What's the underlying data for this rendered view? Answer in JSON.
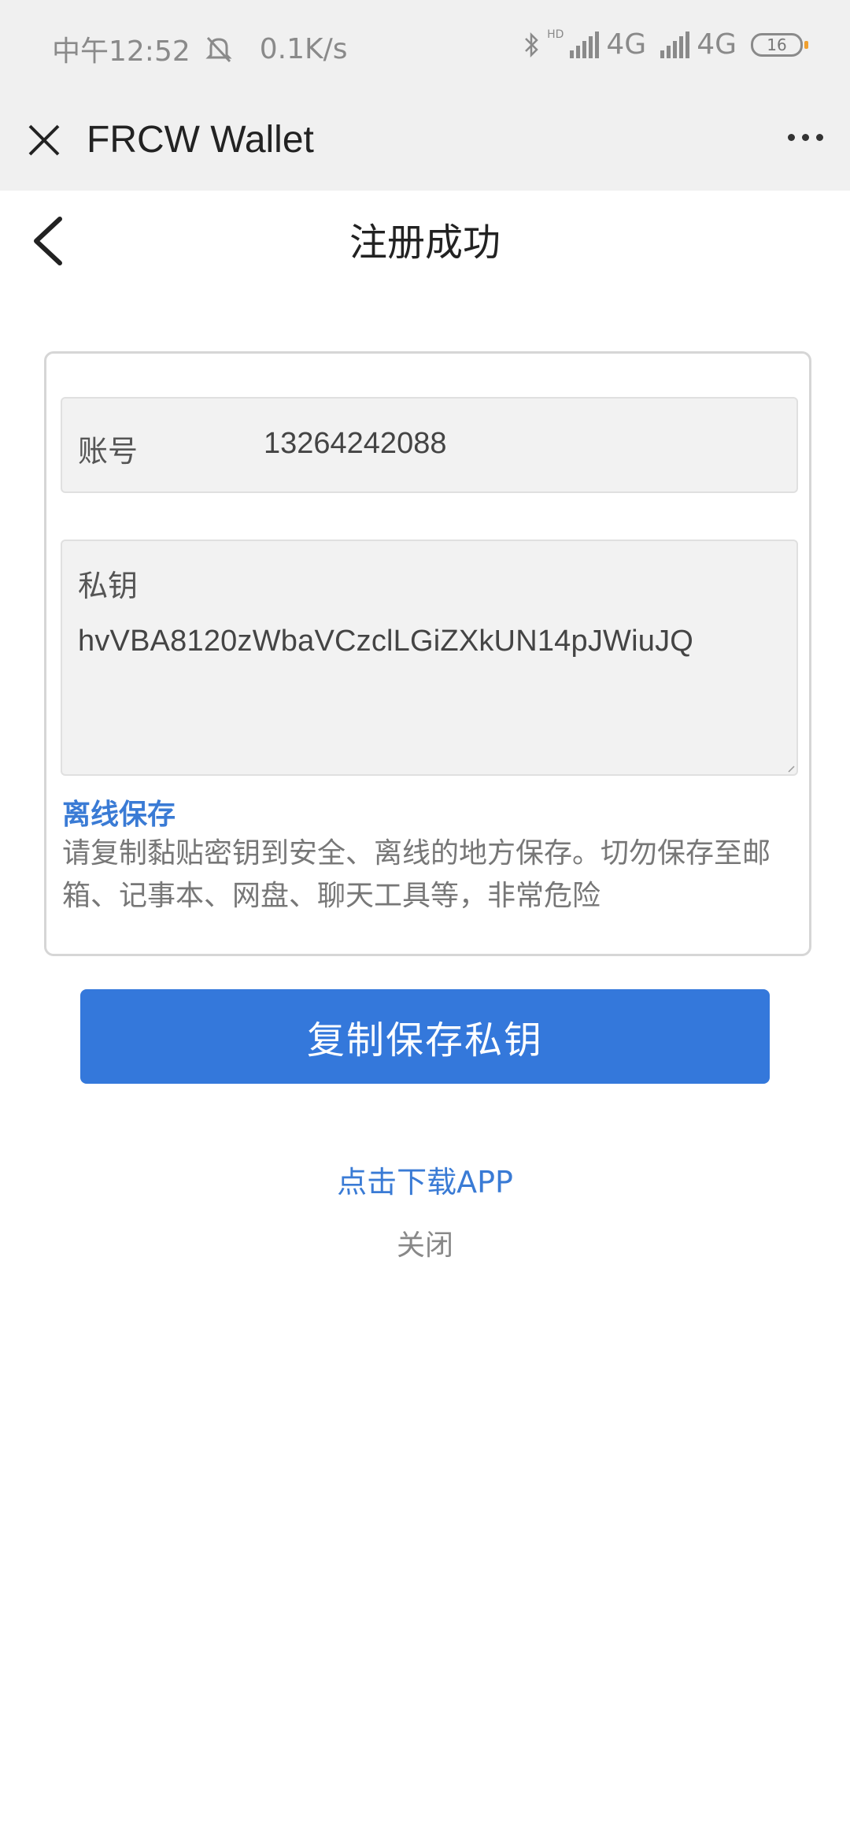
{
  "status_bar": {
    "time": "中午12:52",
    "speed": "0.1K/s",
    "hd": "HD",
    "net1": "4G",
    "net2": "4G",
    "battery": "16"
  },
  "app_bar": {
    "title": "FRCW Wallet",
    "close_icon": "close-icon",
    "more_icon": "more-icon"
  },
  "header": {
    "title": "注册成功",
    "back_icon": "chevron-left-icon"
  },
  "card": {
    "account_label": "账号",
    "account_value": "13264242088",
    "key_label": "私钥",
    "key_value": "hvVBA8120zWbaVCzclLGiZXkUN14pJWiuJQ",
    "offline_title": "离线保存",
    "offline_desc": "请复制黏贴密钥到安全、离线的地方保存。切勿保存至邮箱、记事本、网盘、聊天工具等，非常危险"
  },
  "actions": {
    "copy_button": "复制保存私钥",
    "download_link": "点击下载APP",
    "close_link": "关闭"
  },
  "colors": {
    "accent": "#3478db",
    "link": "#3a7bd5",
    "bar_bg": "#f0f0f0"
  }
}
